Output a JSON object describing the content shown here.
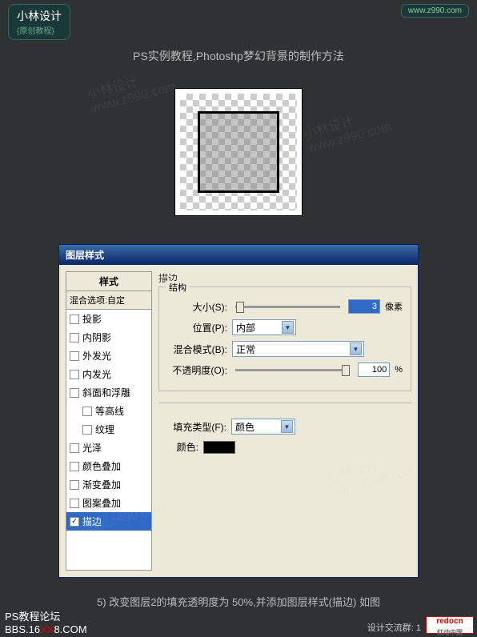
{
  "header": {
    "logo_title": "小林设计",
    "logo_sub": "{原创教程}",
    "url": "www.z990.com"
  },
  "page_title": "PS实例教程,Photoshp梦幻背景的制作方法",
  "watermarks": {
    "text": "小林设计",
    "url": "www.z990.com"
  },
  "dialog": {
    "title": "图层样式",
    "style_list": {
      "header": "样式",
      "blend_options": "混合选项:自定",
      "items": [
        {
          "label": "投影",
          "checked": false
        },
        {
          "label": "内阴影",
          "checked": false
        },
        {
          "label": "外发光",
          "checked": false
        },
        {
          "label": "内发光",
          "checked": false
        },
        {
          "label": "斜面和浮雕",
          "checked": false
        },
        {
          "label": "等高线",
          "checked": false,
          "indent": true
        },
        {
          "label": "纹理",
          "checked": false,
          "indent": true
        },
        {
          "label": "光泽",
          "checked": false
        },
        {
          "label": "颜色叠加",
          "checked": false
        },
        {
          "label": "渐变叠加",
          "checked": false
        },
        {
          "label": "图案叠加",
          "checked": false
        },
        {
          "label": "描边",
          "checked": true,
          "selected": true
        }
      ]
    },
    "stroke": {
      "section_label": "描边",
      "structure_label": "结构",
      "size_label": "大小(S):",
      "size_value": "3",
      "size_unit": "像素",
      "position_label": "位置(P):",
      "position_value": "内部",
      "blend_label": "混合模式(B):",
      "blend_value": "正常",
      "opacity_label": "不透明度(O):",
      "opacity_value": "100",
      "opacity_unit": "%",
      "fill_type_label": "填充类型(F):",
      "fill_type_value": "颜色",
      "color_label": "颜色:",
      "color_value": "#000000"
    }
  },
  "caption": "5) 改变图层2的填充透明度为 50%,并添加图层样式(描边) 如图",
  "footer": {
    "forum": "PS教程论坛",
    "bbs_prefix": "BBS.16",
    "bbs_xx": "XX",
    "bbs_suffix": "8.COM",
    "group": "设计交流群: 1",
    "badge": "redocn",
    "badge_sub": "红动中国"
  }
}
